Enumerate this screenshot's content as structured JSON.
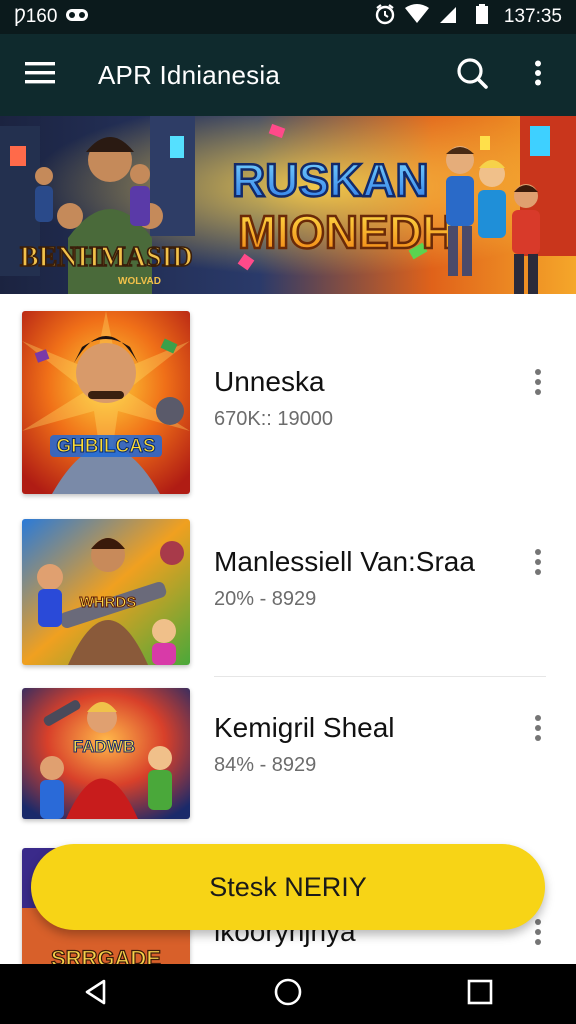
{
  "status_bar": {
    "carrier": "Ƿ160",
    "time": "137:35",
    "icons": [
      "voicemail-icon",
      "alarm-icon",
      "wifi-icon",
      "signal-icon",
      "battery-icon"
    ]
  },
  "toolbar": {
    "title": "APR Idnianesia",
    "icons": [
      "menu-icon",
      "search-icon",
      "more-vertical-icon"
    ]
  },
  "banner": {
    "left_logo": "BENHMASID",
    "left_logo_small": "WOLVAD",
    "title_line1": "RUSKAN",
    "title_line2": "MIONEDH"
  },
  "list": {
    "items": [
      {
        "title": "Unneska",
        "subtitle": "670K:: 19000",
        "thumb_label": "GHBILCAS"
      },
      {
        "title": "Manlessiell Van:Sraa",
        "subtitle": "20% - 8929",
        "thumb_label": "WHRDS"
      },
      {
        "title": "Kemigril Sheal",
        "subtitle": "84% - 8929",
        "thumb_label": "FADWB"
      },
      {
        "title": "lkooryhjhya",
        "subtitle": "",
        "thumb_label": "SRRGADE"
      }
    ]
  },
  "cta": {
    "label": "Stesk NERIY"
  },
  "colors": {
    "status_bar_bg": "#0b1a1c",
    "toolbar_bg": "#0f2a2d",
    "cta_bg": "#f7d416",
    "nav_bg": "#000000"
  },
  "nav_bar": {
    "icons": [
      "back-icon",
      "home-icon",
      "recents-icon"
    ]
  }
}
